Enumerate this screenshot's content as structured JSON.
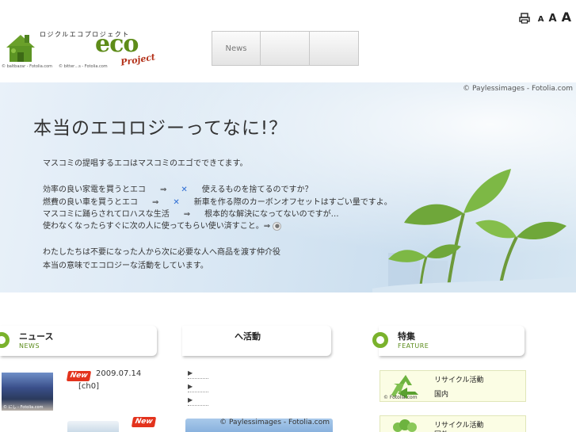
{
  "header": {
    "logo_kana": "ロジクルエコプロジェクト",
    "logo_eco": "eco",
    "logo_project": "Project",
    "logo_credits": [
      "© baltbazar - Fotolia.com",
      "© bitter…s - Fotolia.com"
    ],
    "nav": [
      "News",
      "",
      ""
    ],
    "font_sizes": [
      "A",
      "A",
      "A"
    ]
  },
  "hero": {
    "credit": "© Paylessimages - Fotolia.com",
    "title": "本当のエコロジーってなに!？",
    "intro": "マスコミの提唱するエコはマスコミのエゴでできてます。",
    "rows": [
      {
        "a": "効率の良い家電を買うとエコ",
        "arrow": "⇒",
        "mark": "✕",
        "b": "使えるものを捨てるのですか？"
      },
      {
        "a": "燃費の良い車を買うとエコ",
        "arrow": "⇒",
        "mark": "✕",
        "b": "新車を作る際のカーボンオフセットはすごい量ですよ。"
      },
      {
        "a": "マスコミに踊らされてロハスな生活",
        "arrow": "⇒",
        "b": "根本的な解決になってないのですが…"
      },
      {
        "a": "使わなくなったらすぐに次の人に使ってもらい使い済すこと。⇒"
      }
    ],
    "closing": [
      "わたしたちは不要になった人から次に必要な人へ商品を渡す仲介役",
      "本当の意味でエコロジーな活動をしています。"
    ]
  },
  "sections": {
    "news": {
      "jp": "ニュース",
      "en": "NEWS"
    },
    "activity": {
      "jp": "へ活動"
    },
    "feature": {
      "jp": "特集",
      "en": "FEATURE"
    }
  },
  "news": {
    "badge": "New",
    "date": "2009.07.14",
    "subject": "[ch0]",
    "thumb_credit": "© にし - Fotolia.com",
    "badge2": "New"
  },
  "activity": {
    "bullet": "▶",
    "image_credit": "© Paylessimages - Fotolia.com"
  },
  "feature": {
    "items": [
      {
        "title": "リサイクル活動",
        "sub": "国内",
        "credit": "© Fotolia.com"
      },
      {
        "title": "リサイクル活動",
        "sub": "国外"
      }
    ]
  },
  "colors": {
    "accent_green": "#7ab22c",
    "new_red": "#e3331d",
    "cross_blue": "#2a6bd3"
  }
}
